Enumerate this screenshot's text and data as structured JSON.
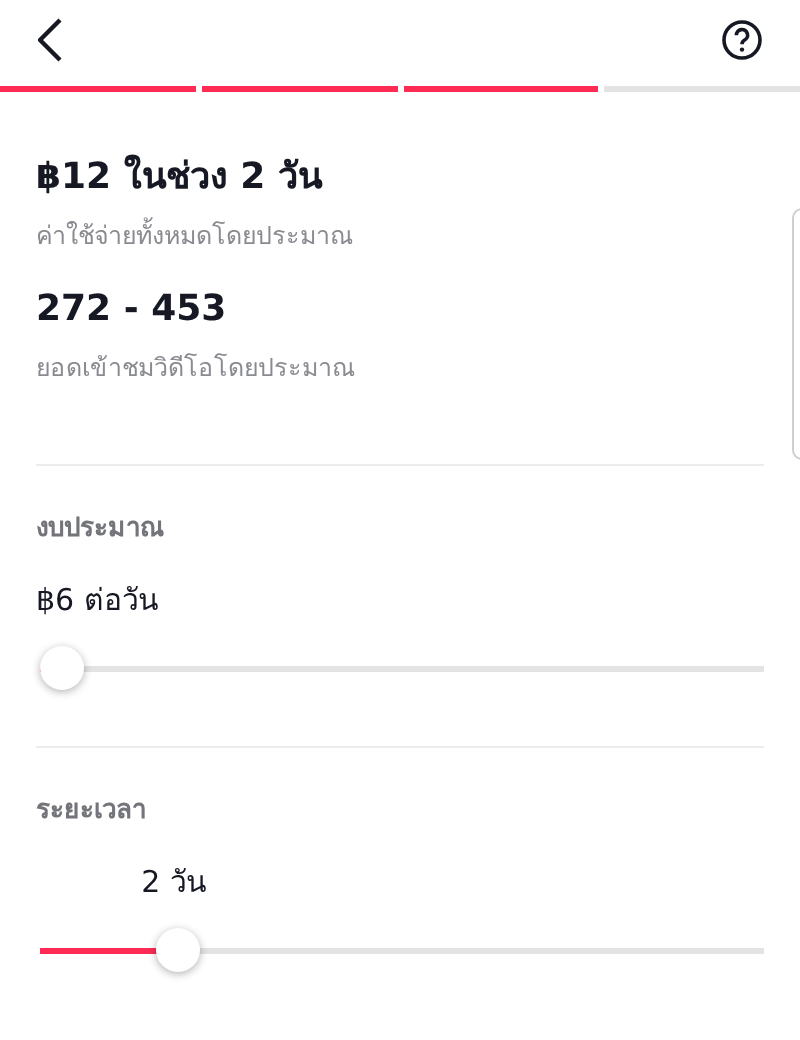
{
  "progress_steps": [
    {
      "done": true
    },
    {
      "done": true
    },
    {
      "done": true
    },
    {
      "done": false
    }
  ],
  "summary": [
    {
      "value": "฿12 ในช่วง 2 วัน",
      "caption": "ค่าใช้จ่ายทั้งหมดโดยประมาณ"
    },
    {
      "value": "272 - 453",
      "caption": "ยอดเข้าชมวิดีโอโดยประมาณ"
    }
  ],
  "settings": [
    {
      "kind": "budget",
      "label": "งบประมาณ",
      "value": "฿6 ต่อวัน",
      "level": 0
    },
    {
      "kind": "duration",
      "label": "ระยะเวลา",
      "value": "2 วัน",
      "level": 0.17
    }
  ]
}
